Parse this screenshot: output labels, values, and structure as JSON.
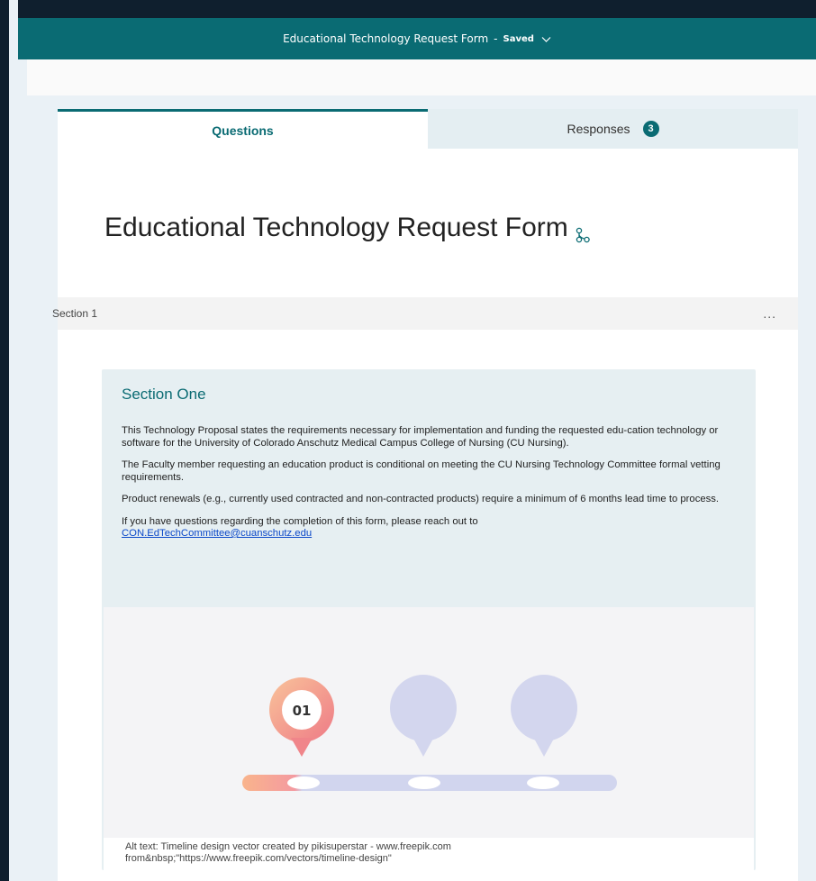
{
  "header": {
    "title": "Educational Technology Request Form",
    "separator": "-",
    "status": "Saved"
  },
  "tabs": [
    {
      "label": "Questions",
      "active": true
    },
    {
      "label": "Responses",
      "count": "3",
      "active": false
    }
  ],
  "form": {
    "title": "Educational Technology Request Form"
  },
  "section": {
    "label": "Section 1",
    "menu": "..."
  },
  "card": {
    "title": "Section One",
    "paragraphs": [
      "This Technology Proposal states the requirements necessary for implementation and funding the requested edu-cation technology or software for the University of Colorado Anschutz Medical Campus College of Nursing (CU Nursing).",
      "The Faculty member requesting an education product is conditional on meeting the CU Nursing Technology Committee formal vetting requirements.",
      "Product renewals (e.g., currently used contracted and non-contracted products) require a minimum of 6 months lead time to process.",
      "If you have questions regarding the completion of this form, please reach out to"
    ],
    "email": "CON.EdTechCommittee@cuanschutz.edu"
  },
  "image": {
    "marker_label": "01",
    "alt_text_line1": "Alt text: Timeline design vector created by pikisuperstar - www.freepik.com",
    "alt_text_line2": "from&nbsp;\"https://www.freepik.com/vectors/timeline-design\""
  },
  "colors": {
    "accent": "#0a6b73",
    "link": "#0b48c9",
    "marker_gradient_start": "#f7b58a",
    "marker_gradient_end": "#ef7d86",
    "inactive_marker": "#d3d6ee"
  },
  "icons": [
    "chevron-down-icon",
    "branching-icon",
    "more-options-icon"
  ]
}
